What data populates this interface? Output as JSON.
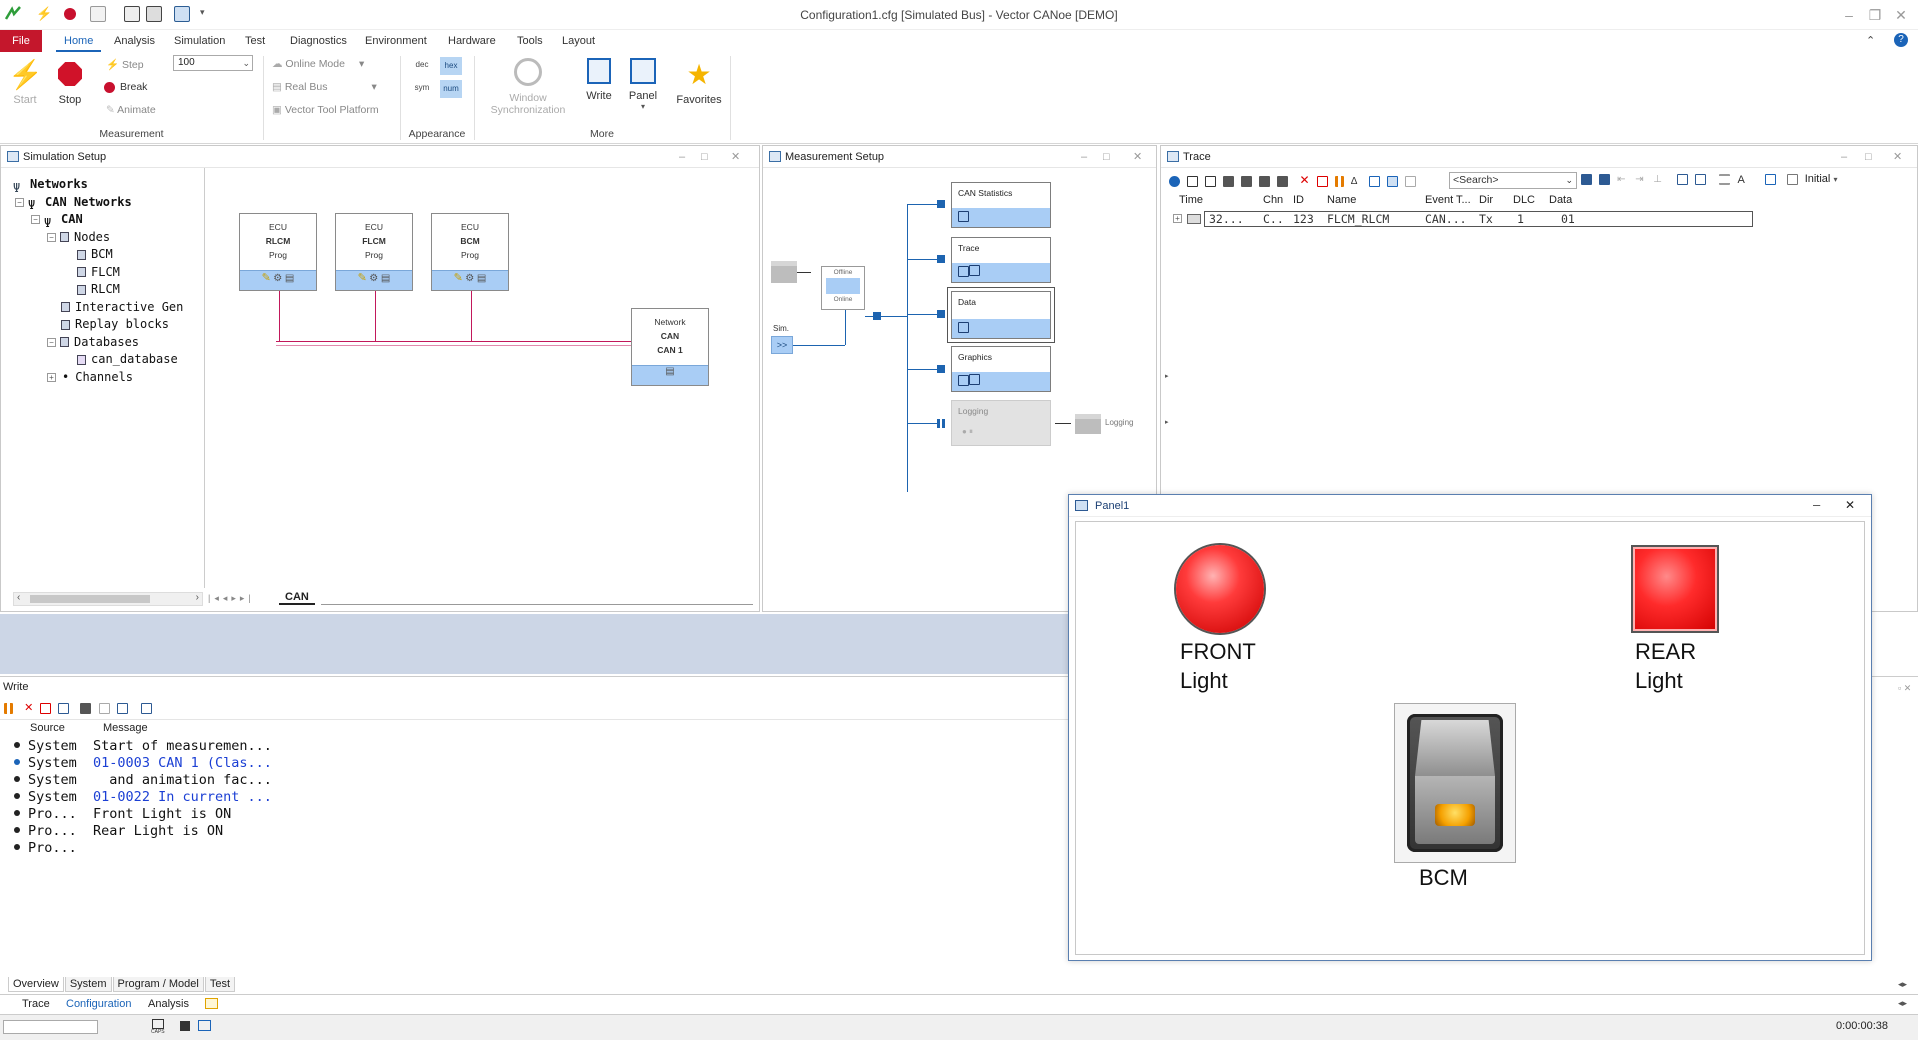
{
  "window": {
    "title": "Configuration1.cfg [Simulated Bus] - Vector CANoe [DEMO]"
  },
  "menu": [
    "File",
    "Home",
    "Analysis",
    "Simulation",
    "Test",
    "Diagnostics",
    "Environment",
    "Hardware",
    "Tools",
    "Layout"
  ],
  "ribbon": {
    "start": "Start",
    "stop": "Stop",
    "step": "Step",
    "break": "Break",
    "animate": "Animate",
    "speed_value": "100",
    "online_mode": "Online Mode",
    "real_bus": "Real Bus",
    "vector_tool_platform": "Vector Tool Platform",
    "dec": "dec",
    "hex": "hex",
    "sym": "sym",
    "num": "num",
    "window_sync_1": "Window",
    "window_sync_2": "Synchronization",
    "write": "Write",
    "panel": "Panel",
    "favorites": "Favorites",
    "groups": {
      "measurement": "Measurement",
      "appearance": "Appearance",
      "more": "More"
    }
  },
  "simulation_setup": {
    "title": "Simulation Setup",
    "tree": {
      "networks": "Networks",
      "can_networks": "CAN Networks",
      "can": "CAN",
      "nodes": "Nodes",
      "bcm": "BCM",
      "flcm": "FLCM",
      "rlcm": "RLCM",
      "interactive": "Interactive Gen",
      "replay": "Replay blocks",
      "databases": "Databases",
      "can_database": "can_database",
      "channels": "Channels"
    },
    "ecus": [
      {
        "type": "ECU",
        "name": "RLCM",
        "prog": "Prog"
      },
      {
        "type": "ECU",
        "name": "FLCM",
        "prog": "Prog"
      },
      {
        "type": "ECU",
        "name": "BCM",
        "prog": "Prog"
      }
    ],
    "network": {
      "type": "Network",
      "name": "CAN",
      "channel": "CAN 1"
    },
    "tab": "CAN"
  },
  "measurement_setup": {
    "title": "Measurement Setup",
    "offline": "Offline",
    "online": "Online",
    "sim": "Sim.",
    "sim_btn": ">>",
    "blocks": [
      "CAN Statistics",
      "Trace",
      "Data",
      "Graphics",
      "Logging"
    ],
    "logging_file": "Logging"
  },
  "trace": {
    "title": "Trace",
    "search_placeholder": "<Search>",
    "initial": "Initial",
    "columns": [
      "Time",
      "Chn",
      "ID",
      "Name",
      "Event T...",
      "Dir",
      "DLC",
      "Data"
    ],
    "rows": [
      [
        "32...",
        "C..",
        "123",
        "FLCM_RLCM",
        "CAN...",
        "Tx",
        "1",
        "01"
      ]
    ]
  },
  "write": {
    "title": "Write",
    "columns": [
      "Source",
      "Message"
    ],
    "rows": [
      {
        "source": "System",
        "message": "Start of measuremen...",
        "type": "normal"
      },
      {
        "source": "System",
        "message": "01-0003 CAN 1 (Clas...",
        "type": "info"
      },
      {
        "source": "System",
        "message": "  and animation fac...",
        "type": "normal"
      },
      {
        "source": "System",
        "message": "01-0022 In current ...",
        "type": "link"
      },
      {
        "source": "Pro...",
        "message": "Front Light is ON",
        "type": "normal"
      },
      {
        "source": "Pro...",
        "message": "Rear Light is ON",
        "type": "normal"
      },
      {
        "source": "Pro...",
        "message": "",
        "type": "normal"
      }
    ],
    "tabs": [
      "Overview",
      "System",
      "Program / Model",
      "Test"
    ]
  },
  "panel1": {
    "title": "Panel1",
    "front_1": "FRONT",
    "front_2": "Light",
    "rear_1": "REAR",
    "rear_2": "Light",
    "bcm": "BCM"
  },
  "bottom_tabs": [
    "Trace",
    "Configuration",
    "Analysis"
  ],
  "status": {
    "time": "0:00:00:38",
    "caps": "CAPS"
  },
  "colors": {
    "accent": "#1b64b8",
    "file_menu": "#c4172c",
    "lamp_red": "#ff2b2b",
    "block_blue": "#a9cdf5"
  }
}
